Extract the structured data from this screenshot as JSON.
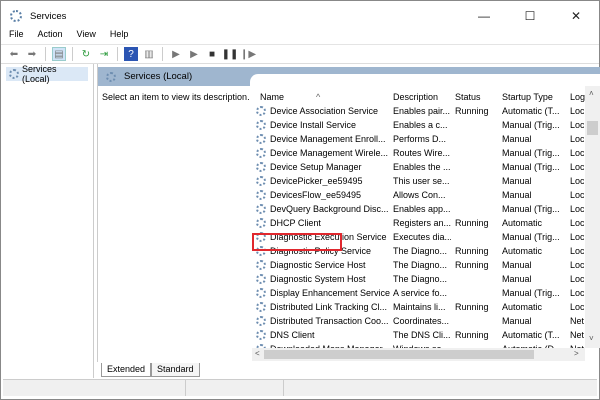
{
  "window": {
    "title": "Services",
    "minimize": "—",
    "maximize": "☐",
    "close": "✕"
  },
  "menu": [
    "File",
    "Action",
    "View",
    "Help"
  ],
  "tree": {
    "root": "Services (Local)"
  },
  "panel": {
    "title": "Services (Local)",
    "description_hint": "Select an item to view its description."
  },
  "columns": [
    "Name",
    "Description",
    "Status",
    "Startup Type",
    "Log"
  ],
  "services": [
    {
      "name": "Device Association Service",
      "description": "Enables pair...",
      "status": "Running",
      "startup": "Automatic (T...",
      "logon": "Loc"
    },
    {
      "name": "Device Install Service",
      "description": "Enables a c...",
      "status": "",
      "startup": "Manual (Trig...",
      "logon": "Loc"
    },
    {
      "name": "Device Management Enroll...",
      "description": "Performs D...",
      "status": "",
      "startup": "Manual",
      "logon": "Loc"
    },
    {
      "name": "Device Management Wirele...",
      "description": "Routes Wire...",
      "status": "",
      "startup": "Manual (Trig...",
      "logon": "Loc"
    },
    {
      "name": "Device Setup Manager",
      "description": "Enables the ...",
      "status": "",
      "startup": "Manual (Trig...",
      "logon": "Loc"
    },
    {
      "name": "DevicePicker_ee59495",
      "description": "This user se...",
      "status": "",
      "startup": "Manual",
      "logon": "Loc"
    },
    {
      "name": "DevicesFlow_ee59495",
      "description": "Allows Con...",
      "status": "",
      "startup": "Manual",
      "logon": "Loc"
    },
    {
      "name": "DevQuery Background Disc...",
      "description": "Enables app...",
      "status": "",
      "startup": "Manual (Trig...",
      "logon": "Loc"
    },
    {
      "name": "DHCP Client",
      "description": "Registers an...",
      "status": "Running",
      "startup": "Automatic",
      "logon": "Loc"
    },
    {
      "name": "Diagnostic Execution Service",
      "description": "Executes dia...",
      "status": "",
      "startup": "Manual (Trig...",
      "logon": "Loc"
    },
    {
      "name": "Diagnostic Policy Service",
      "description": "The Diagno...",
      "status": "Running",
      "startup": "Automatic",
      "logon": "Loc"
    },
    {
      "name": "Diagnostic Service Host",
      "description": "The Diagno...",
      "status": "Running",
      "startup": "Manual",
      "logon": "Loc"
    },
    {
      "name": "Diagnostic System Host",
      "description": "The Diagno...",
      "status": "",
      "startup": "Manual",
      "logon": "Loc"
    },
    {
      "name": "Display Enhancement Service",
      "description": "A service fo...",
      "status": "",
      "startup": "Manual (Trig...",
      "logon": "Loc"
    },
    {
      "name": "Distributed Link Tracking Cl...",
      "description": "Maintains li...",
      "status": "Running",
      "startup": "Automatic",
      "logon": "Loc"
    },
    {
      "name": "Distributed Transaction Coo...",
      "description": "Coordinates...",
      "status": "",
      "startup": "Manual",
      "logon": "Net"
    },
    {
      "name": "DNS Client",
      "description": "The DNS Cli...",
      "status": "Running",
      "startup": "Automatic (T...",
      "logon": "Net"
    },
    {
      "name": "Downloaded Maps Manager",
      "description": "Windows se...",
      "status": "",
      "startup": "Automatic (D...",
      "logon": "Net"
    }
  ],
  "highlighted": "DHCP Client",
  "tabs": [
    "Extended",
    "Standard"
  ],
  "colors": {
    "header": "#9fb6cf",
    "highlight": "#e0282e",
    "selection": "#dbe8f6"
  }
}
